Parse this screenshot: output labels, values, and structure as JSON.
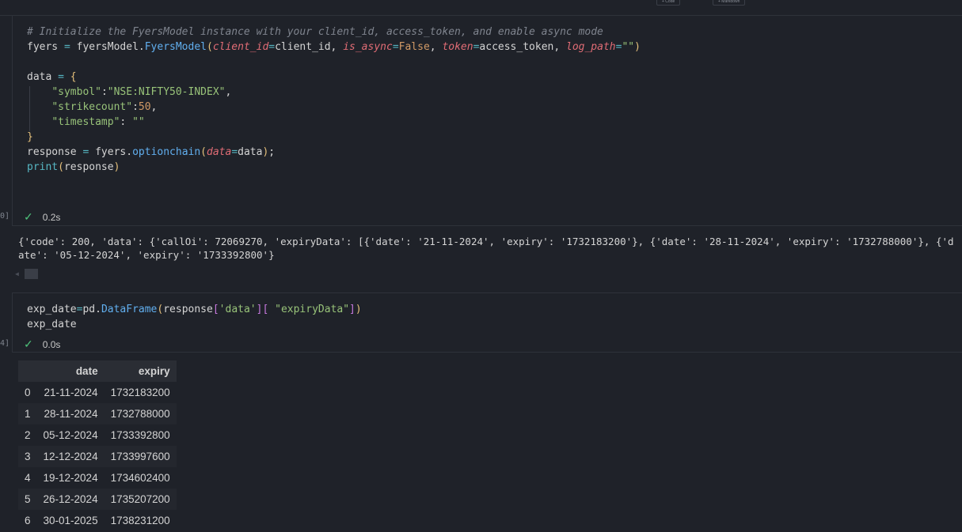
{
  "toolbar": {
    "add_code_label": "+ Code",
    "add_markdown_label": "+ Markdown"
  },
  "cell1": {
    "exec_count": "0]",
    "status_time": "0.2s",
    "lines": [
      [
        [
          "# Initialize the FyersModel instance with your client_id, access_token, and enable async mode",
          "cm"
        ]
      ],
      [
        [
          "fyers ",
          ""
        ],
        [
          "=",
          "op"
        ],
        [
          " fyersModel.",
          ""
        ],
        [
          "FyersModel",
          "fn"
        ],
        [
          "(",
          "br"
        ],
        [
          "client_id",
          "pa"
        ],
        [
          "=",
          "op"
        ],
        [
          "client_id, ",
          ""
        ],
        [
          "is_async",
          "pa"
        ],
        [
          "=",
          "op"
        ],
        [
          "False",
          "nu"
        ],
        [
          ", ",
          ""
        ],
        [
          "token",
          "pa"
        ],
        [
          "=",
          "op"
        ],
        [
          "access_token, ",
          ""
        ],
        [
          "log_path",
          "pa"
        ],
        [
          "=",
          "op"
        ],
        [
          "\"\"",
          "st"
        ],
        [
          ")",
          "br"
        ]
      ],
      [],
      [
        [
          "data ",
          ""
        ],
        [
          "=",
          "op"
        ],
        [
          " ",
          ""
        ],
        [
          "{",
          "br"
        ]
      ],
      [
        [
          "    ",
          ""
        ],
        [
          "\"symbol\"",
          "st"
        ],
        [
          ":",
          ""
        ],
        [
          "\"NSE:NIFTY50-INDEX\"",
          "st"
        ],
        [
          ",",
          ""
        ]
      ],
      [
        [
          "    ",
          ""
        ],
        [
          "\"strikecount\"",
          "st"
        ],
        [
          ":",
          ""
        ],
        [
          "50",
          "nu"
        ],
        [
          ",",
          ""
        ]
      ],
      [
        [
          "    ",
          ""
        ],
        [
          "\"timestamp\"",
          "st"
        ],
        [
          ": ",
          ""
        ],
        [
          "\"\"",
          "st"
        ]
      ],
      [
        [
          "}",
          "br"
        ]
      ],
      [
        [
          "response ",
          ""
        ],
        [
          "=",
          "op"
        ],
        [
          " fyers.",
          ""
        ],
        [
          "optionchain",
          "fn"
        ],
        [
          "(",
          "br"
        ],
        [
          "data",
          "pa"
        ],
        [
          "=",
          "op"
        ],
        [
          "data",
          ""
        ],
        [
          ")",
          "br"
        ],
        [
          ";",
          ""
        ]
      ],
      [
        [
          "print",
          "bi"
        ],
        [
          "(",
          "br"
        ],
        [
          "response",
          ""
        ],
        [
          ")",
          "br"
        ]
      ]
    ],
    "output": "{'code': 200, 'data': {'callOi': 72069270, 'expiryData': [{'date': '21-11-2024', 'expiry': '1732183200'}, {'date': '28-11-2024', 'expiry': '1732788000'}, {'date': '05-12-2024', 'expiry': '1733392800'}"
  },
  "cell2": {
    "exec_count": "4]",
    "status_time": "0.0s",
    "lines": [
      [
        [
          "exp_date",
          ""
        ],
        [
          "=",
          "op"
        ],
        [
          "pd.",
          ""
        ],
        [
          "DataFrame",
          "fn"
        ],
        [
          "(",
          "br"
        ],
        [
          "response",
          ""
        ],
        [
          "[",
          "br2"
        ],
        [
          "'data'",
          "st"
        ],
        [
          "]",
          "br2"
        ],
        [
          "[",
          "br2"
        ],
        [
          " ",
          ""
        ],
        [
          "\"expiryData\"",
          "st"
        ],
        [
          "]",
          "br2"
        ],
        [
          ")",
          "br"
        ]
      ],
      [
        [
          "exp_date",
          ""
        ]
      ]
    ]
  },
  "table": {
    "columns": [
      "",
      "date",
      "expiry"
    ],
    "rows": [
      [
        "0",
        "21-11-2024",
        "1732183200"
      ],
      [
        "1",
        "28-11-2024",
        "1732788000"
      ],
      [
        "2",
        "05-12-2024",
        "1733392800"
      ],
      [
        "3",
        "12-12-2024",
        "1733997600"
      ],
      [
        "4",
        "19-12-2024",
        "1734602400"
      ],
      [
        "5",
        "26-12-2024",
        "1735207200"
      ],
      [
        "6",
        "30-01-2025",
        "1738231200"
      ]
    ]
  }
}
